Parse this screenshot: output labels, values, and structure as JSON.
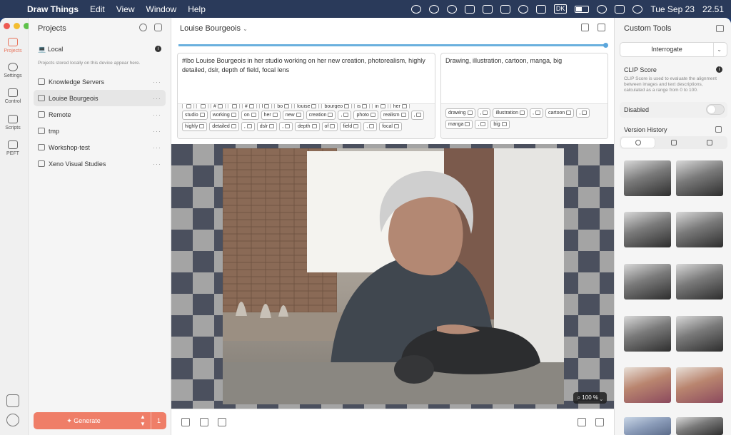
{
  "menubar": {
    "app_name": "Draw Things",
    "menus": [
      "Edit",
      "View",
      "Window",
      "Help"
    ],
    "status_icons": [
      "wechat-icon",
      "cloud-icon",
      "vpn-icon",
      "mail-icon",
      "display-icon",
      "network-icon",
      "cloud-sync-icon",
      "bug-icon"
    ],
    "keyboard_input": "DK",
    "date": "Tue Sep 23",
    "time": "22.51"
  },
  "rail": {
    "items": [
      {
        "label": "Projects",
        "icon": "projects-icon",
        "active": true
      },
      {
        "label": "Settings",
        "icon": "settings-icon",
        "active": false
      },
      {
        "label": "Control",
        "icon": "control-icon",
        "active": false
      },
      {
        "label": "Scripts",
        "icon": "scripts-icon",
        "active": false
      },
      {
        "label": "PEFT",
        "icon": "peft-icon",
        "active": false
      }
    ]
  },
  "projects": {
    "title": "Projects",
    "local_label": "Local",
    "local_note": "Projects stored locally on this device appear here.",
    "items": [
      {
        "name": "Knowledge Servers",
        "selected": false
      },
      {
        "name": "Louise Bourgeois",
        "selected": true
      },
      {
        "name": "Remote",
        "selected": false
      },
      {
        "name": "tmp",
        "selected": false
      },
      {
        "name": "Workshop-test",
        "selected": false
      },
      {
        "name": "Xeno Visual Studies",
        "selected": false
      }
    ],
    "more_glyph": "···",
    "generate_label": "Generate",
    "generate_count": "1"
  },
  "main": {
    "title": "Louise Bourgeois",
    "progress": 1.0,
    "prompt": "#lbo Louise Bourgeois in her studio working on her new creation, photorealism, highly detailed, dslr, depth of field, focal lens",
    "negative_prompt": "Drawing, illustration, cartoon, manga, big",
    "prompt_tokens_row0": [
      "",
      "",
      "#",
      "",
      "#",
      "l",
      "bo",
      "louise",
      "bourgeo",
      "is",
      "in",
      "her"
    ],
    "prompt_tokens": [
      "studio",
      "working",
      "on",
      "her",
      "new",
      "creation",
      ",",
      "photo",
      "realism",
      ",",
      "highly",
      "detailed",
      ",",
      "dslr",
      ",",
      "depth",
      "of",
      "field",
      ",",
      "focal"
    ],
    "negative_tokens": [
      "drawing",
      ",",
      "illustration",
      ",",
      "cartoon",
      ",",
      "manga",
      ",",
      "big"
    ],
    "zoom": "100 %"
  },
  "custom_tools": {
    "title": "Custom Tools",
    "interrogate_label": "Interrogate",
    "clip_title": "CLIP Score",
    "clip_desc": "CLIP Score is used to evaluate the alignment between images and text descriptions, calculated as a range from 0 to 100.",
    "disabled_label": "Disabled",
    "toggle_on": false,
    "version_history_title": "Version History"
  },
  "colors": {
    "accent": "#ef7e68",
    "progress": "#6ab0de",
    "menubar": "#2a3a5a"
  }
}
